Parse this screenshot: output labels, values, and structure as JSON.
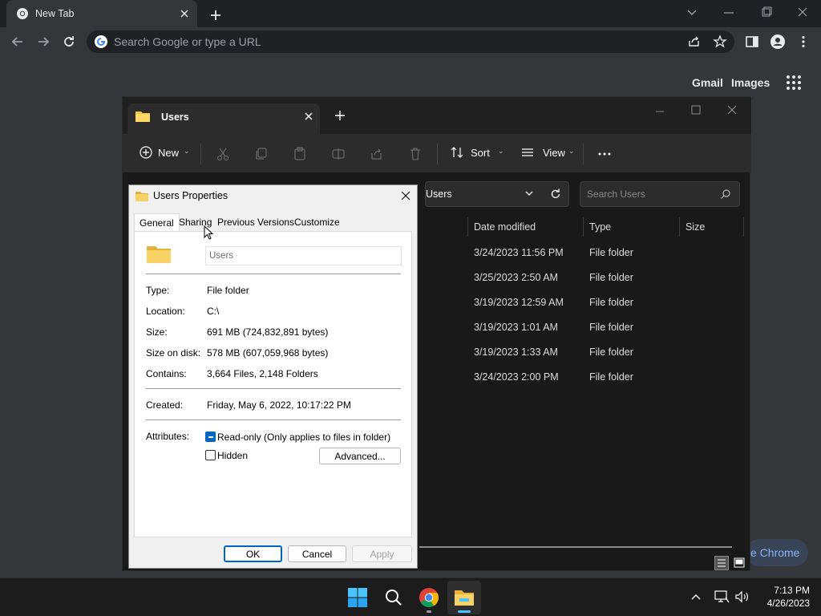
{
  "browser": {
    "tab_title": "New Tab",
    "omnibox_placeholder": "Search Google or type a URL",
    "links": {
      "gmail": "Gmail",
      "images": "Images"
    },
    "chrome_pill": "e Chrome"
  },
  "explorer": {
    "tab_title": "Users",
    "commands": {
      "new": "New",
      "sort": "Sort",
      "view": "View"
    },
    "address": "Users",
    "search_placeholder": "Search Users",
    "columns": {
      "date": "Date modified",
      "type": "Type",
      "size": "Size"
    },
    "rows": [
      {
        "date": "3/24/2023 11:56 PM",
        "type": "File folder"
      },
      {
        "date": "3/25/2023 2:50 AM",
        "type": "File folder"
      },
      {
        "date": "3/19/2023 12:59 AM",
        "type": "File folder"
      },
      {
        "date": "3/19/2023 1:01 AM",
        "type": "File folder"
      },
      {
        "date": "3/19/2023 1:33 AM",
        "type": "File folder"
      },
      {
        "date": "3/24/2023 2:00 PM",
        "type": "File folder"
      }
    ]
  },
  "dialog": {
    "title": "Users Properties",
    "tabs": [
      "General",
      "Sharing",
      "Previous Versions",
      "Customize"
    ],
    "name_value": "Users",
    "fields": [
      {
        "label": "Type:",
        "value": "File folder"
      },
      {
        "label": "Location:",
        "value": "C:\\"
      },
      {
        "label": "Size:",
        "value": "691 MB (724,832,891 bytes)"
      },
      {
        "label": "Size on disk:",
        "value": "578 MB (607,059,968 bytes)"
      },
      {
        "label": "Contains:",
        "value": "3,664 Files, 2,148 Folders"
      }
    ],
    "created": {
      "label": "Created:",
      "value": "Friday, May 6, 2022, 10:17:22 PM"
    },
    "attributes": {
      "label": "Attributes:",
      "readonly": "Read-only (Only applies to files in folder)",
      "hidden": "Hidden",
      "advanced": "Advanced..."
    },
    "buttons": {
      "ok": "OK",
      "cancel": "Cancel",
      "apply": "Apply"
    }
  },
  "taskbar": {
    "time": "7:13 PM",
    "date": "4/26/2023"
  },
  "colors": {
    "accent": "#0067c0",
    "folder": "#f4c542",
    "chrome_bg": "#35363a"
  }
}
